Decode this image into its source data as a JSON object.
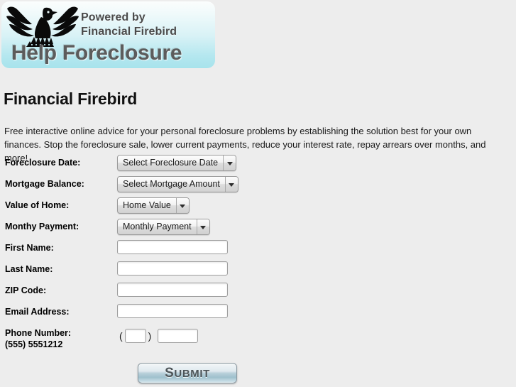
{
  "logo": {
    "bird_icon": "firebird-phoenix-icon",
    "powered_line1": "Powered by",
    "powered_line2": "Financial Firebird",
    "help_text": "Help Foreclosure",
    "bg_top_color": "#fbfdfd",
    "bg_bottom_color": "#a7e3ec"
  },
  "page": {
    "title": "Financial Firebird",
    "intro": "Free interactive online advice for your personal foreclosure problems by establishing the solution best for your own finances. Stop the foreclosure sale, lower current payments, reduce your interest rate, repay arrears over months, and more!",
    "background_color": "#ededed"
  },
  "form": {
    "rows": [
      {
        "label": "Foreclosure Date:",
        "type": "select",
        "value": "Select Foreclosure Date",
        "name": "foreclosure-date"
      },
      {
        "label": "Mortgage Balance:",
        "type": "select",
        "value": "Select Mortgage Amount",
        "name": "mortgage-balance"
      },
      {
        "label": "Value of Home:",
        "type": "select",
        "value": "Home Value",
        "name": "value-of-home"
      },
      {
        "label": "Monthy Payment:",
        "type": "select",
        "value": "Monthly Payment",
        "name": "monthly-payment"
      },
      {
        "label": "First Name:",
        "type": "text",
        "value": "",
        "name": "first-name"
      },
      {
        "label": "Last Name:",
        "type": "text",
        "value": "",
        "name": "last-name"
      },
      {
        "label": "ZIP Code:",
        "type": "text",
        "value": "",
        "name": "zip-code"
      },
      {
        "label": "Email Address:",
        "type": "text",
        "value": "",
        "name": "email-address"
      }
    ],
    "phone": {
      "label": "Phone Number:",
      "hint": "(555) 5551212",
      "open_paren": "(",
      "close_paren": ")",
      "area_value": "",
      "number_value": ""
    },
    "submit": {
      "label_cap": "S",
      "label_rest": "UBMIT"
    }
  }
}
